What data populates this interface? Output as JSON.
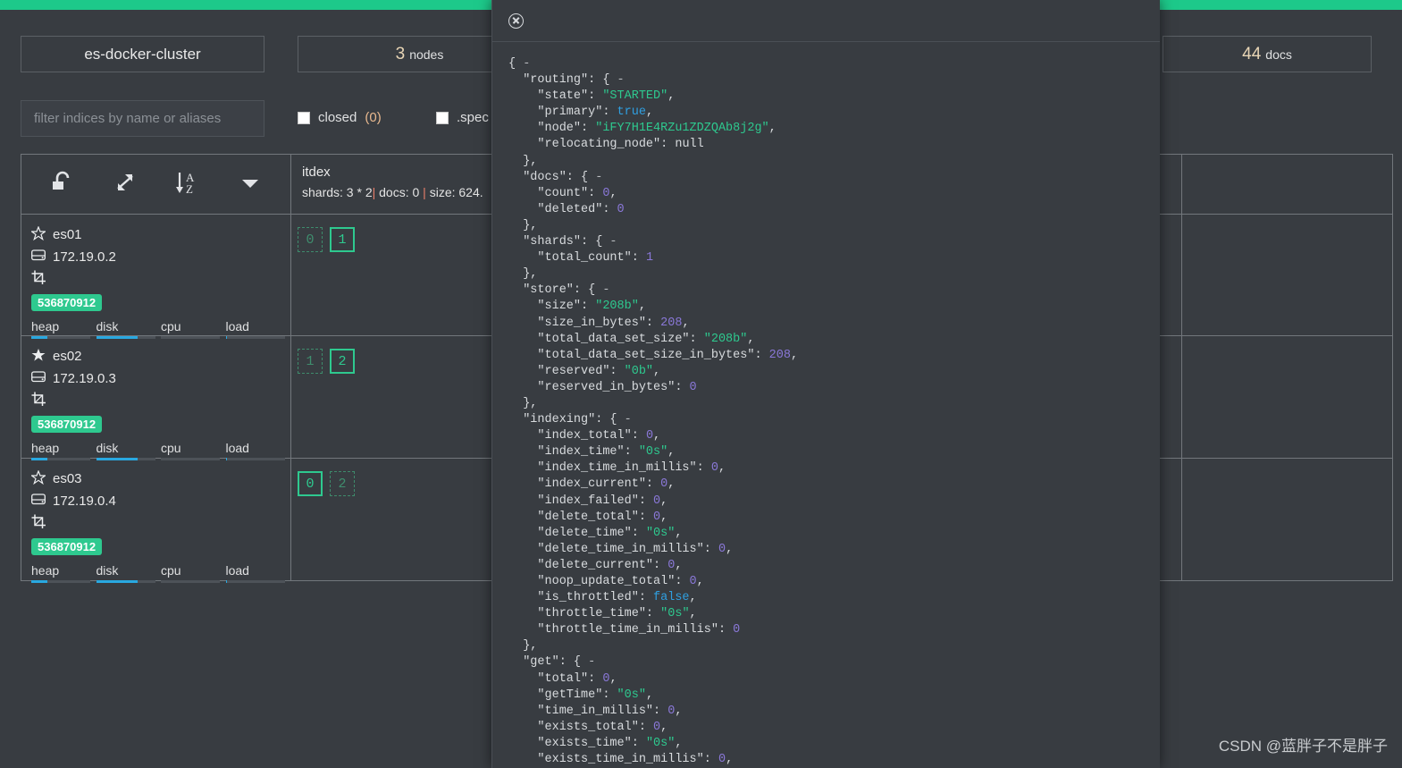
{
  "status_bar": {
    "color": "#1dc98a"
  },
  "header": {
    "cluster_name": "es-docker-cluster",
    "nodes_count": "3",
    "nodes_label": "nodes",
    "docs_count": "44",
    "docs_label": "docs"
  },
  "filter": {
    "placeholder": "filter indices by name or aliases",
    "value": "",
    "checkbox_closed_label": "closed",
    "checkbox_closed_count": "(0)",
    "checkbox_special_label": ".spec"
  },
  "toolbar": {
    "icons": [
      "unlock-icon",
      "expand-icon",
      "sort-az-icon",
      "chevron-down-icon"
    ]
  },
  "index": {
    "name": "itdex",
    "meta_prefix": "shards: 3 * 2",
    "meta_sep1": "|",
    "meta_docs": " docs: 0 ",
    "meta_sep2": "|",
    "meta_size": " size: 624."
  },
  "nodes": [
    {
      "name": "es01",
      "master": false,
      "ip": "172.19.0.2",
      "memory_badge": "536870912",
      "metrics": [
        {
          "label": "heap",
          "pct": 28
        },
        {
          "label": "disk",
          "pct": 70
        },
        {
          "label": "cpu",
          "pct": 0
        },
        {
          "label": "load",
          "pct": 3
        }
      ],
      "shards": [
        {
          "value": "0",
          "type": "replica"
        },
        {
          "value": "1",
          "type": "primary"
        }
      ]
    },
    {
      "name": "es02",
      "master": true,
      "ip": "172.19.0.3",
      "memory_badge": "536870912",
      "metrics": [
        {
          "label": "heap",
          "pct": 28
        },
        {
          "label": "disk",
          "pct": 70
        },
        {
          "label": "cpu",
          "pct": 0
        },
        {
          "label": "load",
          "pct": 3
        }
      ],
      "shards": [
        {
          "value": "1",
          "type": "replica"
        },
        {
          "value": "2",
          "type": "primary"
        }
      ]
    },
    {
      "name": "es03",
      "master": false,
      "ip": "172.19.0.4",
      "memory_badge": "536870912",
      "metrics": [
        {
          "label": "heap",
          "pct": 28
        },
        {
          "label": "disk",
          "pct": 70
        },
        {
          "label": "cpu",
          "pct": 0
        },
        {
          "label": "load",
          "pct": 3
        }
      ],
      "shards": [
        {
          "value": "0",
          "type": "primary"
        },
        {
          "value": "2",
          "type": "replica"
        }
      ]
    }
  ],
  "modal": {
    "close_icon": "close-circle-icon",
    "json_lines": [
      [
        {
          "t": "punct",
          "s": "{ "
        },
        {
          "t": "fold",
          "s": "-"
        }
      ],
      [
        {
          "t": "key",
          "s": "  \"routing\": { "
        },
        {
          "t": "fold",
          "s": "-"
        }
      ],
      [
        {
          "t": "key",
          "s": "    \"state\": "
        },
        {
          "t": "str",
          "s": "\"STARTED\""
        },
        {
          "t": "punct",
          "s": ","
        }
      ],
      [
        {
          "t": "key",
          "s": "    \"primary\": "
        },
        {
          "t": "bool",
          "s": "true"
        },
        {
          "t": "punct",
          "s": ","
        }
      ],
      [
        {
          "t": "key",
          "s": "    \"node\": "
        },
        {
          "t": "str",
          "s": "\"iFY7H1E4RZu1ZDZQAb8j2g\""
        },
        {
          "t": "punct",
          "s": ","
        }
      ],
      [
        {
          "t": "key",
          "s": "    \"relocating_node\": "
        },
        {
          "t": "null",
          "s": "null"
        }
      ],
      [
        {
          "t": "punct",
          "s": "  },"
        }
      ],
      [
        {
          "t": "key",
          "s": "  \"docs\": { "
        },
        {
          "t": "fold",
          "s": "-"
        }
      ],
      [
        {
          "t": "key",
          "s": "    \"count\": "
        },
        {
          "t": "num",
          "s": "0"
        },
        {
          "t": "punct",
          "s": ","
        }
      ],
      [
        {
          "t": "key",
          "s": "    \"deleted\": "
        },
        {
          "t": "num",
          "s": "0"
        }
      ],
      [
        {
          "t": "punct",
          "s": "  },"
        }
      ],
      [
        {
          "t": "key",
          "s": "  \"shards\": { "
        },
        {
          "t": "fold",
          "s": "-"
        }
      ],
      [
        {
          "t": "key",
          "s": "    \"total_count\": "
        },
        {
          "t": "num",
          "s": "1"
        }
      ],
      [
        {
          "t": "punct",
          "s": "  },"
        }
      ],
      [
        {
          "t": "key",
          "s": "  \"store\": { "
        },
        {
          "t": "fold",
          "s": "-"
        }
      ],
      [
        {
          "t": "key",
          "s": "    \"size\": "
        },
        {
          "t": "str",
          "s": "\"208b\""
        },
        {
          "t": "punct",
          "s": ","
        }
      ],
      [
        {
          "t": "key",
          "s": "    \"size_in_bytes\": "
        },
        {
          "t": "num",
          "s": "208"
        },
        {
          "t": "punct",
          "s": ","
        }
      ],
      [
        {
          "t": "key",
          "s": "    \"total_data_set_size\": "
        },
        {
          "t": "str",
          "s": "\"208b\""
        },
        {
          "t": "punct",
          "s": ","
        }
      ],
      [
        {
          "t": "key",
          "s": "    \"total_data_set_size_in_bytes\": "
        },
        {
          "t": "num",
          "s": "208"
        },
        {
          "t": "punct",
          "s": ","
        }
      ],
      [
        {
          "t": "key",
          "s": "    \"reserved\": "
        },
        {
          "t": "str",
          "s": "\"0b\""
        },
        {
          "t": "punct",
          "s": ","
        }
      ],
      [
        {
          "t": "key",
          "s": "    \"reserved_in_bytes\": "
        },
        {
          "t": "num",
          "s": "0"
        }
      ],
      [
        {
          "t": "punct",
          "s": "  },"
        }
      ],
      [
        {
          "t": "key",
          "s": "  \"indexing\": { "
        },
        {
          "t": "fold",
          "s": "-"
        }
      ],
      [
        {
          "t": "key",
          "s": "    \"index_total\": "
        },
        {
          "t": "num",
          "s": "0"
        },
        {
          "t": "punct",
          "s": ","
        }
      ],
      [
        {
          "t": "key",
          "s": "    \"index_time\": "
        },
        {
          "t": "str",
          "s": "\"0s\""
        },
        {
          "t": "punct",
          "s": ","
        }
      ],
      [
        {
          "t": "key",
          "s": "    \"index_time_in_millis\": "
        },
        {
          "t": "num",
          "s": "0"
        },
        {
          "t": "punct",
          "s": ","
        }
      ],
      [
        {
          "t": "key",
          "s": "    \"index_current\": "
        },
        {
          "t": "num",
          "s": "0"
        },
        {
          "t": "punct",
          "s": ","
        }
      ],
      [
        {
          "t": "key",
          "s": "    \"index_failed\": "
        },
        {
          "t": "num",
          "s": "0"
        },
        {
          "t": "punct",
          "s": ","
        }
      ],
      [
        {
          "t": "key",
          "s": "    \"delete_total\": "
        },
        {
          "t": "num",
          "s": "0"
        },
        {
          "t": "punct",
          "s": ","
        }
      ],
      [
        {
          "t": "key",
          "s": "    \"delete_time\": "
        },
        {
          "t": "str",
          "s": "\"0s\""
        },
        {
          "t": "punct",
          "s": ","
        }
      ],
      [
        {
          "t": "key",
          "s": "    \"delete_time_in_millis\": "
        },
        {
          "t": "num",
          "s": "0"
        },
        {
          "t": "punct",
          "s": ","
        }
      ],
      [
        {
          "t": "key",
          "s": "    \"delete_current\": "
        },
        {
          "t": "num",
          "s": "0"
        },
        {
          "t": "punct",
          "s": ","
        }
      ],
      [
        {
          "t": "key",
          "s": "    \"noop_update_total\": "
        },
        {
          "t": "num",
          "s": "0"
        },
        {
          "t": "punct",
          "s": ","
        }
      ],
      [
        {
          "t": "key",
          "s": "    \"is_throttled\": "
        },
        {
          "t": "bool",
          "s": "false"
        },
        {
          "t": "punct",
          "s": ","
        }
      ],
      [
        {
          "t": "key",
          "s": "    \"throttle_time\": "
        },
        {
          "t": "str",
          "s": "\"0s\""
        },
        {
          "t": "punct",
          "s": ","
        }
      ],
      [
        {
          "t": "key",
          "s": "    \"throttle_time_in_millis\": "
        },
        {
          "t": "num",
          "s": "0"
        }
      ],
      [
        {
          "t": "punct",
          "s": "  },"
        }
      ],
      [
        {
          "t": "key",
          "s": "  \"get\": { "
        },
        {
          "t": "fold",
          "s": "-"
        }
      ],
      [
        {
          "t": "key",
          "s": "    \"total\": "
        },
        {
          "t": "num",
          "s": "0"
        },
        {
          "t": "punct",
          "s": ","
        }
      ],
      [
        {
          "t": "key",
          "s": "    \"getTime\": "
        },
        {
          "t": "str",
          "s": "\"0s\""
        },
        {
          "t": "punct",
          "s": ","
        }
      ],
      [
        {
          "t": "key",
          "s": "    \"time_in_millis\": "
        },
        {
          "t": "num",
          "s": "0"
        },
        {
          "t": "punct",
          "s": ","
        }
      ],
      [
        {
          "t": "key",
          "s": "    \"exists_total\": "
        },
        {
          "t": "num",
          "s": "0"
        },
        {
          "t": "punct",
          "s": ","
        }
      ],
      [
        {
          "t": "key",
          "s": "    \"exists_time\": "
        },
        {
          "t": "str",
          "s": "\"0s\""
        },
        {
          "t": "punct",
          "s": ","
        }
      ],
      [
        {
          "t": "key",
          "s": "    \"exists_time_in_millis\": "
        },
        {
          "t": "num",
          "s": "0"
        },
        {
          "t": "punct",
          "s": ","
        }
      ]
    ]
  },
  "watermark": {
    "text": "CSDN @蓝胖子不是胖子"
  }
}
